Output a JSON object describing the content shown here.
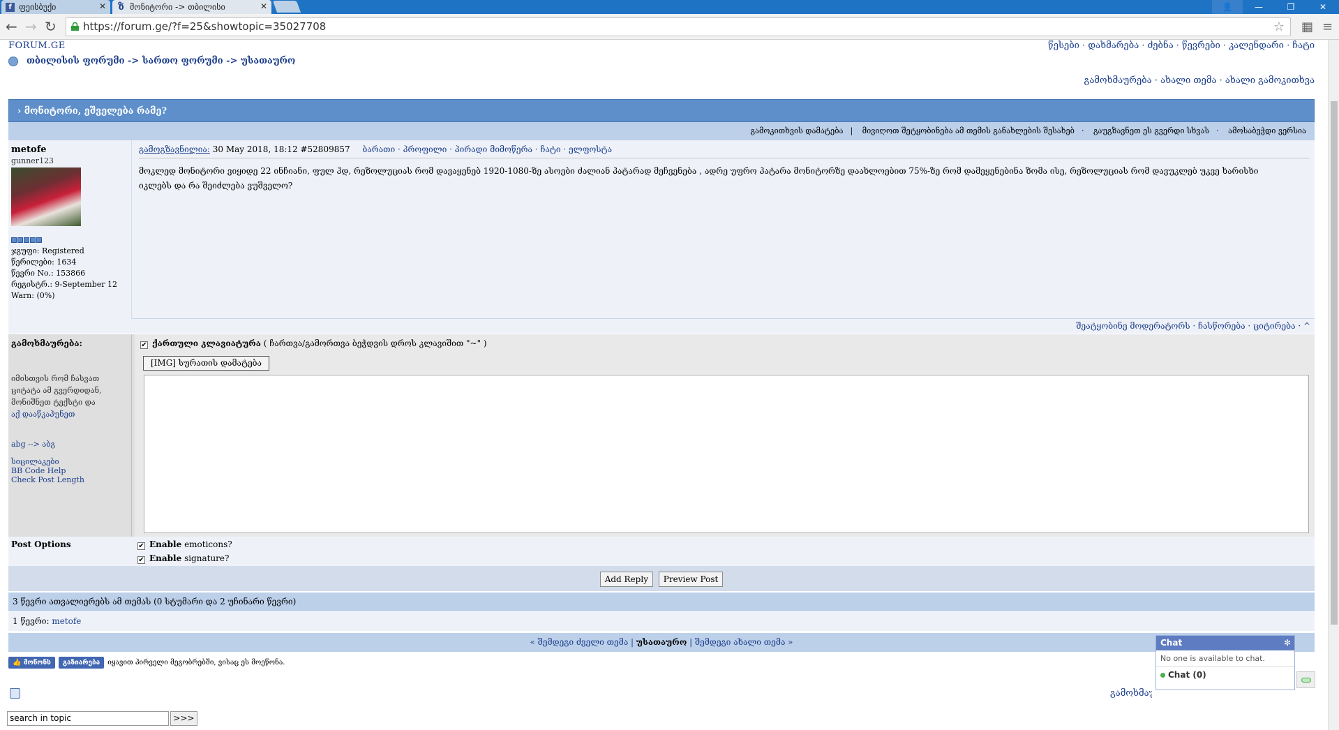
{
  "browser": {
    "tabs": [
      {
        "title": "ფეისბუქი",
        "favicon": "facebook-icon",
        "active": false
      },
      {
        "title": "მონიტორი -> თბილისი",
        "favicon": "forum-b-icon",
        "active": true
      }
    ],
    "url": "https://forum.ge/?f=25&showtopic=35027708",
    "tab_bar_color": "#1e73c4"
  },
  "site": {
    "logo": "FORUM.GE",
    "top_nav": "წესები · დახმარება · ძებნა · წევრები · კალენდარი · ჩატი",
    "breadcrumb": "თბილისის ფორუმი -> სართო ფორუმი -> უსათაურო",
    "top_actions": "გამოხმაურება · ახალი თემა · ახალი გამოკითხვა",
    "accent_color": "#5e8fca"
  },
  "topic": {
    "title": "› მონიტორი, ეშველება რამე?",
    "options_bar": {
      "add_poll": "გამოკითხვის დამატება",
      "notify": "მივიღოთ შეტყობინება ამ თემის განახლების შესახებ",
      "send_page": "გაუგზავნეთ ეს გვერდი სხვას",
      "print": "ამოსაბეჭდი ვერსია"
    }
  },
  "post": {
    "username": "metofe",
    "user_title": "gunner123",
    "user_info": [
      "ჯგუფი: Registered",
      "წერილები: 1634",
      "წევრი No.: 153866",
      "რეგისტრ.: 9-September 12",
      "Warn: (0%)"
    ],
    "posted_label": "გამოგზავნილია:",
    "posted_date": "30 May 2018, 18:12",
    "post_number": "#52809857",
    "post_links": "ბარათი · პროფილი · პირადი მიმოწერა · ჩატი · ელფოსტა",
    "body": "მოკლედ მონიტორი ვიყიდე 22 ინჩიანი, ფულ ჰდ, რეზოლუციას რომ დავაყენებ 1920-1080-ზე ასოები ძალიან პატარად მეჩვენება , ადრე უფრო პატარა მონიტორზე დაახლოებით 75%-ზე რომ დამეყენებინა ზომა ისე, რეზოლუციას რომ დავუკლებ უკვე ხარისხი იკლებს და რა შეიძლება ვუშველო?",
    "footer_links": "შეატყობინე მოდერატორს · ჩასწორება · ციტირება · ^"
  },
  "reply": {
    "label": "გამოხმაურება:",
    "hint": "იმისთვის რომ ჩასვათ ციტატა ამ გვერდიდან, მონიშნეთ ტექსტი და",
    "hint_link": "აქ დააწკაპუნეთ",
    "translit": "abg --> აბგ",
    "smilies": "სიცილაკები",
    "bb_help": "BB Code Help",
    "check_length": "Check Post Length",
    "keyboard_label": "ქართული კლავიატურა",
    "keyboard_hint": "( ჩართვა/გამორთვა ბეჭდვის დროს კლავიშით \"~\" )",
    "img_button": "[IMG] სურათის დამატება",
    "textarea_value": ""
  },
  "post_options": {
    "label": "Post Options",
    "emoticons_bold": "Enable",
    "emoticons_rest": "emoticons?",
    "signature_bold": "Enable",
    "signature_rest": "signature?"
  },
  "buttons": {
    "add_reply": "Add Reply",
    "preview": "Preview Post"
  },
  "readers": {
    "summary": "3 წევრი ათვალიერებს ამ თემას (0 სტუმარი და 2 უჩინარი წევრი)",
    "members_prefix": "1 წევრი:",
    "member": "metofe"
  },
  "topic_nav": {
    "prev": "« შემდეგი ძველი თემა",
    "current": "უსათაურო",
    "next": "შემდეგი ახალი თემა »"
  },
  "facebook": {
    "like": "მოწონს",
    "share": "გაზიარება",
    "text": "იყავით პირველი მეგობრებში, ვისაც ეს მოეწონა."
  },
  "search": {
    "placeholder": "search in topic",
    "go": ">>>"
  },
  "bottom_actions": "გამოხმაურება",
  "chat": {
    "title": "Chat",
    "empty": "No one is available to chat.",
    "count": "Chat (0)"
  }
}
